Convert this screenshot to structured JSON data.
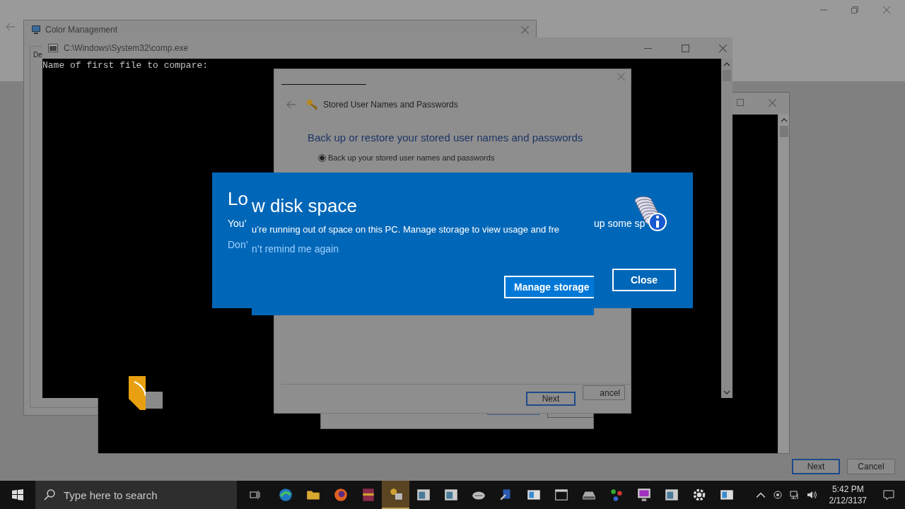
{
  "color_management": {
    "title": "Color Management",
    "tab": "De"
  },
  "console": {
    "title": "C:\\Windows\\System32\\comp.exe",
    "output": "Name of first file to compare:"
  },
  "credential_wizard": {
    "nav_title": "Stored User Names and Passwords",
    "heading": "Back up or restore your stored user names and passwords",
    "options": [
      {
        "label": "Back up your stored user names and passwords",
        "selected": true
      }
    ],
    "next": "Next",
    "cancel": "ancel"
  },
  "toast": {
    "title_fragment": "Lo",
    "title": "w disk space",
    "message_fragment": "You’",
    "message": "u’re running out of space on this PC. Manage storage to view usage and fre",
    "message_end": "up some sp",
    "link_fragment": "Don’",
    "link": "n’t remind me again",
    "primary": "Manage storage",
    "close": "Close"
  },
  "background_buttons": [
    "Next",
    "Cancel"
  ],
  "taskbar": {
    "search": {
      "placeholder": "Type here to search"
    },
    "apps": [
      {
        "kind": "edge",
        "selected": false
      },
      {
        "kind": "folder",
        "selected": false
      },
      {
        "kind": "firefox",
        "selected": false
      },
      {
        "kind": "archive",
        "selected": false
      },
      {
        "kind": "keys",
        "selected": true
      },
      {
        "kind": "window",
        "selected": false
      },
      {
        "kind": "window",
        "selected": false
      },
      {
        "kind": "cloud",
        "selected": false
      },
      {
        "kind": "setup",
        "selected": false
      },
      {
        "kind": "panel",
        "selected": false
      },
      {
        "kind": "console",
        "selected": false
      },
      {
        "kind": "drive",
        "selected": false
      },
      {
        "kind": "network",
        "selected": false
      },
      {
        "kind": "monitor",
        "selected": false
      },
      {
        "kind": "window",
        "selected": false
      },
      {
        "kind": "gear",
        "selected": false
      },
      {
        "kind": "panel",
        "selected": false
      }
    ],
    "time": "5:42 PM",
    "date": "2/12/3137"
  }
}
